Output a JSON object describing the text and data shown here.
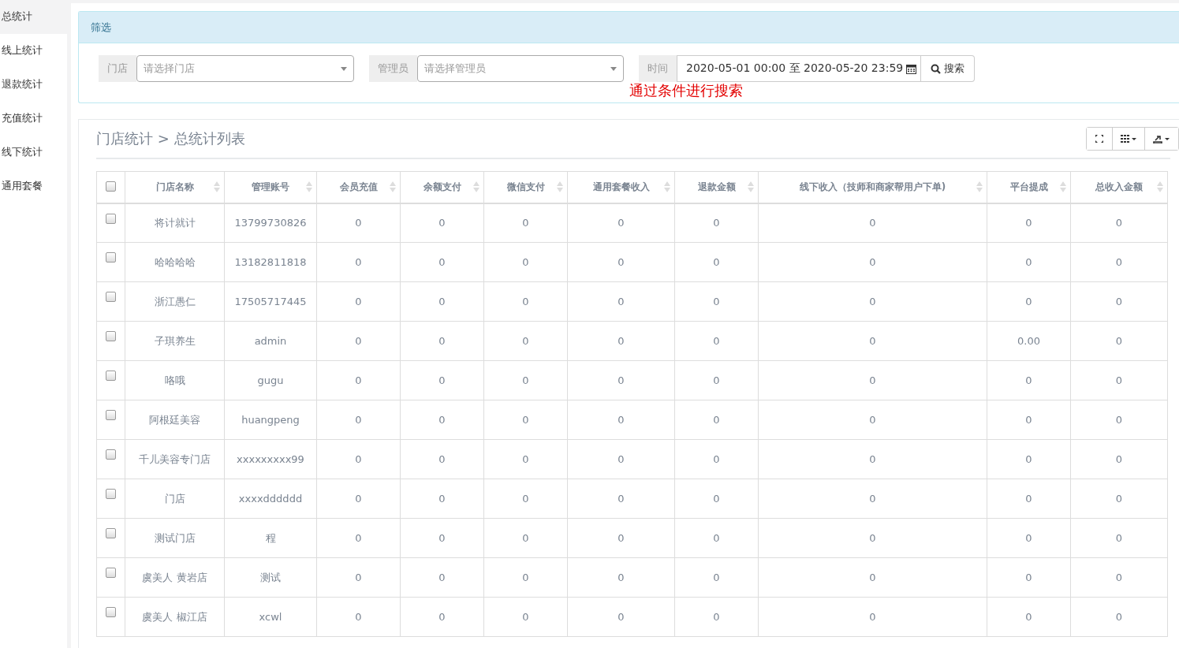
{
  "sidebar": {
    "items": [
      {
        "label": "总统计",
        "selected": true
      },
      {
        "label": "线上统计",
        "selected": false
      },
      {
        "label": "退款统计",
        "selected": false
      },
      {
        "label": "充值统计",
        "selected": false
      },
      {
        "label": "线下统计",
        "selected": false
      },
      {
        "label": "通用套餐",
        "selected": false
      }
    ]
  },
  "filter": {
    "title": "筛选",
    "store": {
      "label": "门店",
      "placeholder": "请选择门店"
    },
    "manager": {
      "label": "管理员",
      "placeholder": "请选择管理员"
    },
    "time": {
      "label": "时间",
      "value": "2020-05-01 00:00 至 2020-05-20 23:59"
    },
    "search_button": "搜索",
    "hint": "通过条件进行搜索"
  },
  "table_panel": {
    "title": "门店统计 > 总统计列表",
    "header_checked": false,
    "columns": [
      "门店名称",
      "管理账号",
      "会员充值",
      "余额支付",
      "微信支付",
      "通用套餐收入",
      "退款金额",
      "线下收入（技师和商家帮用户下单)",
      "平台提成",
      "总收入金额"
    ],
    "rows": [
      {
        "checked": false,
        "cells": [
          "将计就计",
          "13799730826",
          "0",
          "0",
          "0",
          "0",
          "0",
          "0",
          "0",
          "0"
        ]
      },
      {
        "checked": false,
        "cells": [
          "哈哈哈哈",
          "13182811818",
          "0",
          "0",
          "0",
          "0",
          "0",
          "0",
          "0",
          "0"
        ]
      },
      {
        "checked": false,
        "cells": [
          "浙江愚仁",
          "17505717445",
          "0",
          "0",
          "0",
          "0",
          "0",
          "0",
          "0",
          "0"
        ]
      },
      {
        "checked": false,
        "cells": [
          "子琪养生",
          "admin",
          "0",
          "0",
          "0",
          "0",
          "0",
          "0",
          "0.00",
          "0"
        ]
      },
      {
        "checked": false,
        "cells": [
          "咯哦",
          "gugu",
          "0",
          "0",
          "0",
          "0",
          "0",
          "0",
          "0",
          "0"
        ]
      },
      {
        "checked": false,
        "cells": [
          "阿根廷美容",
          "huangpeng",
          "0",
          "0",
          "0",
          "0",
          "0",
          "0",
          "0",
          "0"
        ]
      },
      {
        "checked": false,
        "cells": [
          "千儿美容专门店",
          "xxxxxxxxx99",
          "0",
          "0",
          "0",
          "0",
          "0",
          "0",
          "0",
          "0"
        ]
      },
      {
        "checked": false,
        "cells": [
          "门店",
          "xxxxdddddd",
          "0",
          "0",
          "0",
          "0",
          "0",
          "0",
          "0",
          "0"
        ]
      },
      {
        "checked": false,
        "cells": [
          "测试门店",
          "程",
          "0",
          "0",
          "0",
          "0",
          "0",
          "0",
          "0",
          "0"
        ]
      },
      {
        "checked": false,
        "cells": [
          "虞美人 黄岩店",
          "测试",
          "0",
          "0",
          "0",
          "0",
          "0",
          "0",
          "0",
          "0"
        ]
      },
      {
        "checked": false,
        "cells": [
          "虞美人 椒江店",
          "xcwl",
          "0",
          "0",
          "0",
          "0",
          "0",
          "0",
          "0",
          "0"
        ]
      }
    ]
  }
}
